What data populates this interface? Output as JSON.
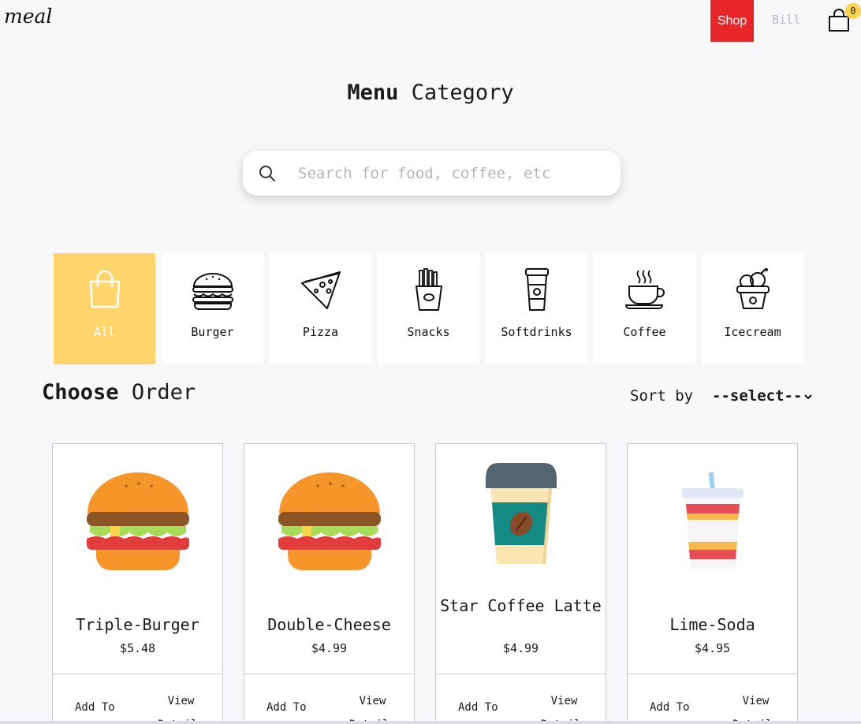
{
  "header": {
    "logo": "meal",
    "nav": {
      "shop": "Shop",
      "bill": "Bill"
    },
    "cart_count": "0"
  },
  "menu": {
    "title_bold": "Menu",
    "title_rest": "Category"
  },
  "search": {
    "placeholder": "Search for food, coffee, etc",
    "value": ""
  },
  "categories": [
    {
      "label": "All",
      "icon": "shopping-bag-icon",
      "active": true
    },
    {
      "label": "Burger",
      "icon": "burger-icon"
    },
    {
      "label": "Pizza",
      "icon": "pizza-icon"
    },
    {
      "label": "Snacks",
      "icon": "fries-icon"
    },
    {
      "label": "Softdrinks",
      "icon": "cup-icon"
    },
    {
      "label": "Coffee",
      "icon": "coffee-icon"
    },
    {
      "label": "Icecream",
      "icon": "icecream-icon"
    }
  ],
  "order": {
    "title_bold": "Choose",
    "title_rest": "Order",
    "sort_label": "Sort by",
    "sort_value": "--select--"
  },
  "products": [
    {
      "name": "Triple-Burger",
      "price": "$5.48",
      "add": "Add To",
      "view": "View Details",
      "icon": "burger-image"
    },
    {
      "name": "Double-Cheese",
      "price": "$4.99",
      "add": "Add To",
      "view": "View Details",
      "icon": "burger-image"
    },
    {
      "name": "Star Coffee Latte",
      "price": "$4.99",
      "add": "Add To",
      "view": "View Details",
      "icon": "coffee-cup-image"
    },
    {
      "name": "Lime-Soda",
      "price": "$4.95",
      "add": "Add To",
      "view": "View Details",
      "icon": "soda-cup-image"
    }
  ],
  "colors": {
    "accent_red": "#e8262a",
    "accent_yellow": "#fed56b",
    "badge": "#fbd34a"
  }
}
